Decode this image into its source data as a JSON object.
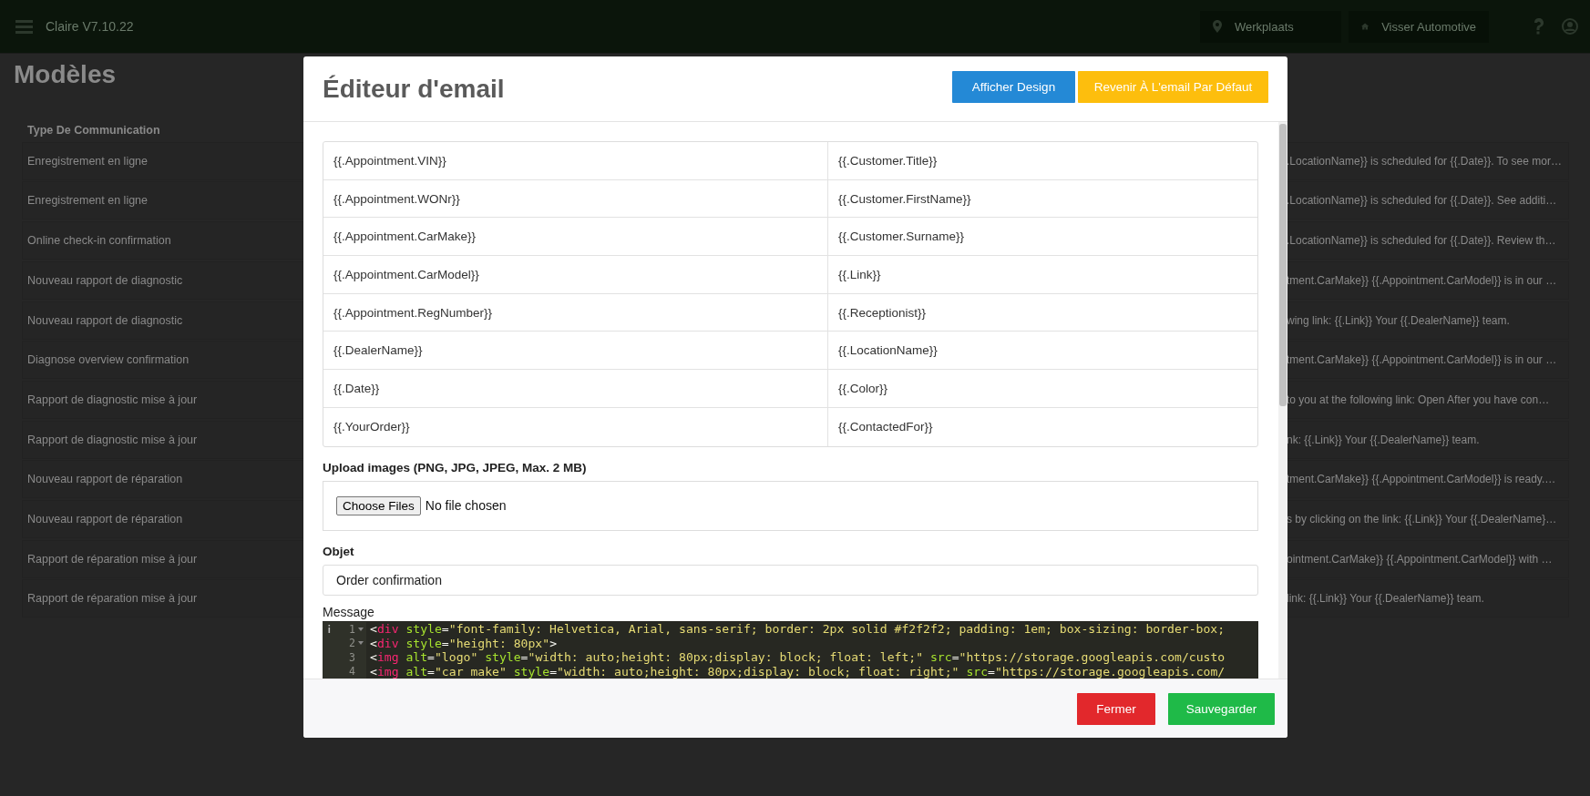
{
  "top_bar": {
    "app_title": "Claire V7.10.22",
    "location": "Werkplaats",
    "dealer": "Visser Automotive"
  },
  "page": {
    "title": "Modèles",
    "table": {
      "columns": [
        "Type De Communication"
      ],
      "rows": [
        {
          "type": "Enregistrement en ligne",
          "column_3": ".LocationName}} is scheduled for {{.Date}}. To see mor…"
        },
        {
          "type": "Enregistrement en ligne",
          "column_3": ".LocationName}} is scheduled for {{.Date}}. See additi…"
        },
        {
          "type": "Online check-in confirmation",
          "column_3": ".LocationName}} is scheduled for {{.Date}}. Review th…"
        },
        {
          "type": "Nouveau rapport de diagnostic",
          "column_3": "tment.CarMake}} {{.Appointment.CarModel}} is in our …"
        },
        {
          "type": "Nouveau rapport de diagnostic",
          "column_3": "wing link: {{.Link}} Your {{.DealerName}} team."
        },
        {
          "type": "Diagnose overview confirmation",
          "column_3": "tment.CarMake}} {{.Appointment.CarModel}} is in our …"
        },
        {
          "type": "Rapport de diagnostic mise à jour",
          "column_3": "to you at the following link: Open After you have con…"
        },
        {
          "type": "Rapport de diagnostic mise à jour",
          "column_3": "nk: {{.Link}} Your {{.DealerName}} team."
        },
        {
          "type": "Nouveau rapport de réparation",
          "column_3": "tment.CarMake}} {{.Appointment.CarModel}} is ready.…"
        },
        {
          "type": "Nouveau rapport de réparation",
          "column_3": "s by clicking on the link: {{.Link}} Your {{.DealerName}…"
        },
        {
          "type": "Rapport de réparation mise à jour",
          "column_3": "ointment.CarMake}} {{.Appointment.CarModel}} with …"
        },
        {
          "type": "Rapport de réparation mise à jour",
          "column_3": "link: {{.Link}} Your {{.DealerName}} team."
        }
      ]
    }
  },
  "modal": {
    "title": "Éditeur d'email",
    "header_buttons": [
      {
        "label": "Afficher Design",
        "kind": "primary"
      },
      {
        "label": "Revenir À L'email Par Défaut",
        "kind": "warning"
      }
    ],
    "variables": [
      [
        "{{.Appointment.VIN}}",
        "{{.Customer.Title}}"
      ],
      [
        "{{.Appointment.WONr}}",
        "{{.Customer.FirstName}}"
      ],
      [
        "{{.Appointment.CarMake}}",
        "{{.Customer.Surname}}"
      ],
      [
        "{{.Appointment.CarModel}}",
        "{{.Link}}"
      ],
      [
        "{{.Appointment.RegNumber}}",
        "{{.Receptionist}}"
      ],
      [
        "{{.DealerName}}",
        "{{.LocationName}}"
      ],
      [
        "{{.Date}}",
        "{{.Color}}"
      ],
      [
        "{{.YourOrder}}",
        "{{.ContactedFor}}"
      ]
    ],
    "upload": {
      "label": "Upload images (PNG, JPG, JPEG, Max. 2 MB)",
      "button": "Choose Files",
      "status": "No file chosen"
    },
    "subject": {
      "label": "Objet",
      "value": "Order confirmation"
    },
    "message": {
      "label": "Message",
      "lines": [
        {
          "number": "1",
          "fold": true,
          "info": true,
          "tokens": [
            {
              "kind": "punct",
              "text": "<"
            },
            {
              "kind": "tag",
              "text": "div"
            },
            {
              "kind": "attr",
              "text": " style"
            },
            {
              "kind": "punct",
              "text": "="
            },
            {
              "kind": "string",
              "text": "\"font-family: Helvetica, Arial, sans-serif; border: 2px solid #f2f2f2; padding: 1em; box-sizing: border-box;"
            }
          ]
        },
        {
          "number": "2",
          "fold": true,
          "info": false,
          "tokens": [
            {
              "kind": "punct",
              "text": "<"
            },
            {
              "kind": "tag",
              "text": "div"
            },
            {
              "kind": "attr",
              "text": " style"
            },
            {
              "kind": "punct",
              "text": "="
            },
            {
              "kind": "string",
              "text": "\"height: 80px\""
            },
            {
              "kind": "punct",
              "text": ">"
            }
          ]
        },
        {
          "number": "3",
          "fold": false,
          "info": false,
          "tokens": [
            {
              "kind": "punct",
              "text": "<"
            },
            {
              "kind": "tag",
              "text": "img"
            },
            {
              "kind": "attr",
              "text": " alt"
            },
            {
              "kind": "punct",
              "text": "="
            },
            {
              "kind": "string",
              "text": "\"logo\""
            },
            {
              "kind": "attr",
              "text": " style"
            },
            {
              "kind": "punct",
              "text": "="
            },
            {
              "kind": "string",
              "text": "\"width: auto;height: 80px;display: block; float: left;\""
            },
            {
              "kind": "attr",
              "text": " src"
            },
            {
              "kind": "punct",
              "text": "="
            },
            {
              "kind": "string",
              "text": "\"https://storage.googleapis.com/custo"
            }
          ]
        },
        {
          "number": "4",
          "fold": false,
          "info": false,
          "tokens": [
            {
              "kind": "punct",
              "text": "<"
            },
            {
              "kind": "tag",
              "text": "img"
            },
            {
              "kind": "attr",
              "text": " alt"
            },
            {
              "kind": "punct",
              "text": "="
            },
            {
              "kind": "string",
              "text": "\"car make\""
            },
            {
              "kind": "attr",
              "text": " style"
            },
            {
              "kind": "punct",
              "text": "="
            },
            {
              "kind": "string",
              "text": "\"width: auto;height: 80px;display: block; float: right;\""
            },
            {
              "kind": "attr",
              "text": " src"
            },
            {
              "kind": "punct",
              "text": "="
            },
            {
              "kind": "string",
              "text": "\"https://storage.googleapis.com/"
            }
          ]
        }
      ]
    },
    "footer_buttons": [
      {
        "label": "Fermer",
        "kind": "danger"
      },
      {
        "label": "Sauvegarder",
        "kind": "success"
      }
    ]
  }
}
